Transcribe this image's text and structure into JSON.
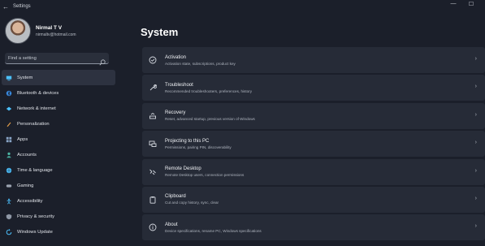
{
  "window": {
    "title": "Settings",
    "back_glyph": "←",
    "min_glyph": "—",
    "max_glyph": "☐"
  },
  "profile": {
    "name": "Nirmal T V",
    "email": "nirmaltv@hotmail.com"
  },
  "search": {
    "placeholder": "Find a setting"
  },
  "nav": [
    {
      "label": "System",
      "icon": "system-icon",
      "color": "#4cc2ff",
      "active": true
    },
    {
      "label": "Bluetooth & devices",
      "icon": "bluetooth-icon",
      "color": "#3a8ee6"
    },
    {
      "label": "Network & internet",
      "icon": "network-icon",
      "color": "#4cc2ff"
    },
    {
      "label": "Personalization",
      "icon": "brush-icon",
      "color": "#e8a24a"
    },
    {
      "label": "Apps",
      "icon": "apps-icon",
      "color": "#8aa6c8"
    },
    {
      "label": "Accounts",
      "icon": "account-icon",
      "color": "#4cb7a5"
    },
    {
      "label": "Time & language",
      "icon": "globe-icon",
      "color": "#4cc2ff"
    },
    {
      "label": "Gaming",
      "icon": "gaming-icon",
      "color": "#9ba3b0"
    },
    {
      "label": "Accessibility",
      "icon": "accessibility-icon",
      "color": "#4cc2ff"
    },
    {
      "label": "Privacy & security",
      "icon": "shield-icon",
      "color": "#8e97a5"
    },
    {
      "label": "Windows Update",
      "icon": "update-icon",
      "color": "#4cc2ff"
    }
  ],
  "main": {
    "title": "System",
    "cards": [
      {
        "title": "Activation",
        "desc": "Activation state, subscriptions, product key",
        "icon": "activation-icon"
      },
      {
        "title": "Troubleshoot",
        "desc": "Recommended troubleshooters, preferences, history",
        "icon": "wrench-icon"
      },
      {
        "title": "Recovery",
        "desc": "Reset, advanced startup, previous version of Windows",
        "icon": "recovery-icon"
      },
      {
        "title": "Projecting to this PC",
        "desc": "Permissions, pairing PIN, discoverability",
        "icon": "projecting-icon"
      },
      {
        "title": "Remote Desktop",
        "desc": "Remote Desktop users, connection permissions",
        "icon": "remote-desktop-icon"
      },
      {
        "title": "Clipboard",
        "desc": "Cut and copy history, sync, clear",
        "icon": "clipboard-icon"
      },
      {
        "title": "About",
        "desc": "Device specifications, rename PC, Windows specifications",
        "icon": "info-icon"
      }
    ],
    "chevron_glyph": "›"
  }
}
